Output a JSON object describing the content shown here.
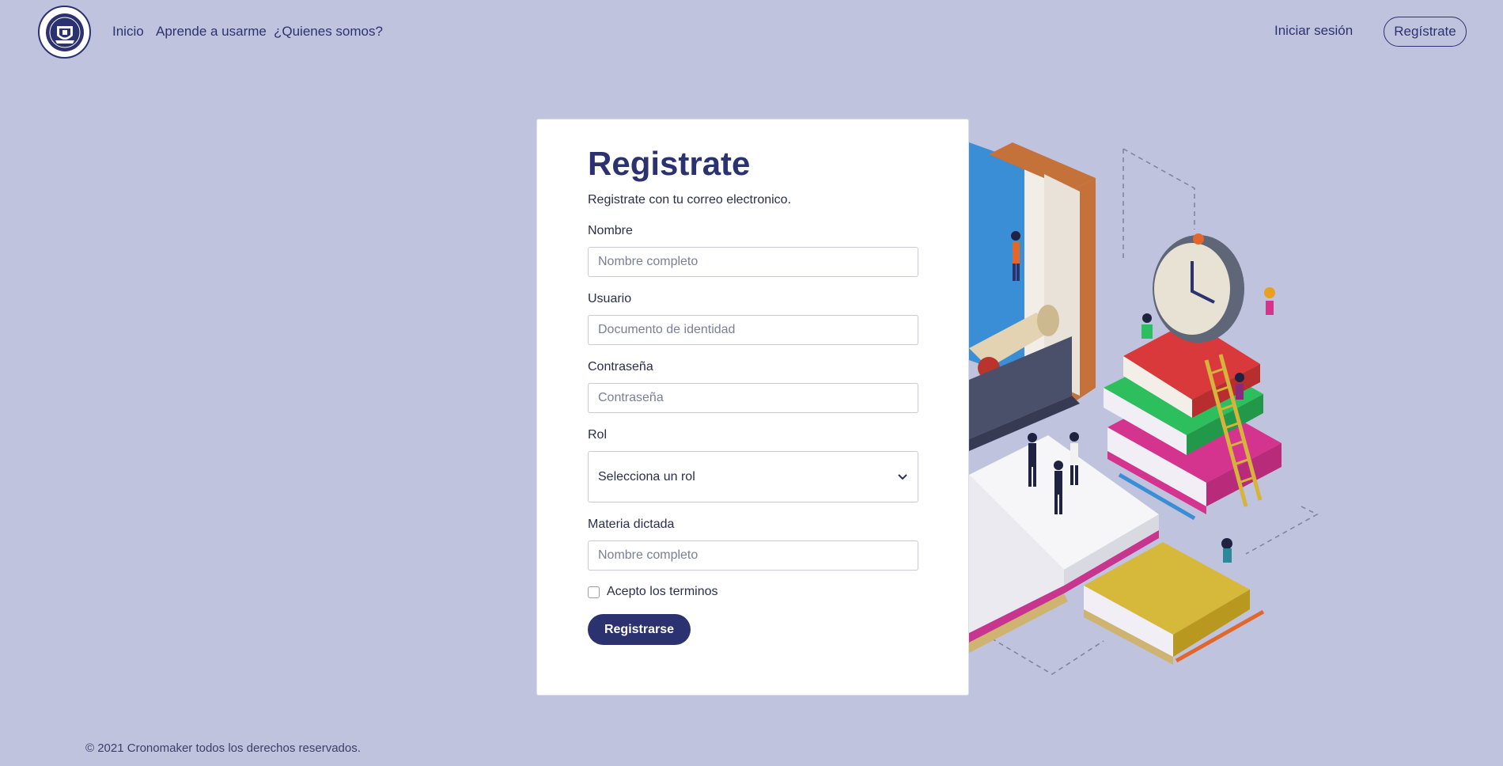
{
  "nav": {
    "logo_icon": "school-crest-logo",
    "links": [
      "Inicio",
      "Aprende a usarme",
      "¿Quienes somos?"
    ],
    "login": "Iniciar sesión",
    "register": "Regístrate"
  },
  "form": {
    "title": "Registrate",
    "subtitle": "Registrate con tu correo electronico.",
    "fields": {
      "nombre": {
        "label": "Nombre",
        "placeholder": "Nombre completo"
      },
      "usuario": {
        "label": "Usuario",
        "placeholder": "Documento de identidad"
      },
      "password": {
        "label": "Contraseña",
        "placeholder": "Contraseña"
      },
      "rol": {
        "label": "Rol",
        "value": "Selecciona un rol"
      },
      "materia": {
        "label": "Materia dictada",
        "placeholder": "Nombre completo"
      }
    },
    "terms": "Acepto los terminos",
    "submit": "Registrarse"
  },
  "colors": {
    "primary": "#2c3270",
    "background": "#c0c3de"
  },
  "footer": "© 2021 Cronomaker todos los derechos reservados."
}
